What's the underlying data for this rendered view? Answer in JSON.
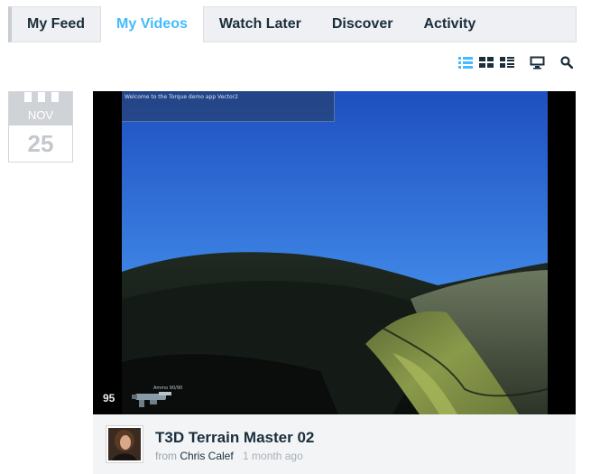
{
  "nav": {
    "tabs": [
      {
        "label": "My Feed"
      },
      {
        "label": "My Videos",
        "active": true
      },
      {
        "label": "Watch Later"
      },
      {
        "label": "Discover"
      },
      {
        "label": "Activity"
      }
    ]
  },
  "toolbar": {
    "icons": [
      "detail-list-view-icon",
      "grid-view-icon",
      "thumbnail-list-view-icon",
      "monitor-icon",
      "search-icon"
    ],
    "active_view": "detail-list-view-icon",
    "active_color": "#44bbff"
  },
  "post": {
    "date": {
      "month": "NOV",
      "day": "25"
    },
    "video": {
      "overlay_text": "Welcome to the Torque demo app Vector2",
      "hud_ammo": "95",
      "hud_weapon_label": "Ammo 90/90"
    },
    "title": "T3D Terrain Master 02",
    "byline": {
      "prefix": "from",
      "author": "Chris Calef",
      "time": "1 month ago"
    }
  },
  "colors": {
    "text": "#1a2e3b",
    "accent": "#44bbff",
    "muted": "#9aa3ab",
    "panel": "#f2f4f6"
  }
}
